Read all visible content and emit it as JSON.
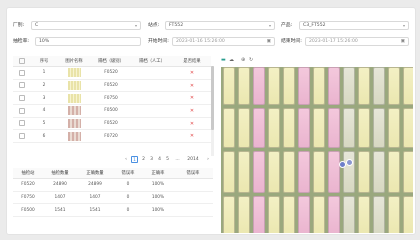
{
  "filters": {
    "factory_label": "厂别:",
    "factory_value": "C",
    "station_label": "站点:",
    "station_value": "FT552",
    "product_label": "产品:",
    "product_value": "C3_FT552",
    "ratio_label": "抽检率:",
    "ratio_value": "10%",
    "start_label": "开始时间:",
    "start_value": "2023-01-16 15:26:00",
    "end_label": "结束时间:",
    "end_value": "2023-01-17 15:26:00"
  },
  "image_table": {
    "headers": [
      "序号",
      "图片名称",
      "隔档（级别）",
      "隔档（人工）",
      "是否结果"
    ],
    "rows": [
      {
        "no": "1",
        "thumb": "a",
        "grade": "F0520",
        "manual": "",
        "result": "✕"
      },
      {
        "no": "2",
        "thumb": "a",
        "grade": "F0520",
        "manual": "",
        "result": "✕"
      },
      {
        "no": "3",
        "thumb": "a",
        "grade": "F0750",
        "manual": "",
        "result": "✕"
      },
      {
        "no": "4",
        "thumb": "b",
        "grade": "F0500",
        "manual": "",
        "result": "✕"
      },
      {
        "no": "5",
        "thumb": "b",
        "grade": "F0520",
        "manual": "",
        "result": "✕"
      },
      {
        "no": "6",
        "thumb": "b",
        "grade": "F0720",
        "manual": "",
        "result": "✕"
      }
    ]
  },
  "pagination": {
    "prev": "‹",
    "pages": [
      "1",
      "2",
      "3",
      "4",
      "5",
      "...",
      "2014"
    ],
    "next": "›"
  },
  "summary_table": {
    "headers": [
      "抽检站",
      "抽检数量",
      "正确数量",
      "错误率",
      "正确率",
      "错误率"
    ],
    "rows": [
      [
        "F0520",
        "24890",
        "24899",
        "0",
        "100%",
        ""
      ],
      [
        "F0750",
        "1407",
        "1407",
        "0",
        "100%",
        ""
      ],
      [
        "F0500",
        "1541",
        "1541",
        "0",
        "100%",
        ""
      ]
    ]
  },
  "viewer": {
    "toolbar_icons": [
      "image-icon",
      "cloud-icon",
      "zoom-icon",
      "refresh-icon"
    ],
    "colors": {
      "yellow": "#f0edbf",
      "pink": "#efbfd6",
      "gray": "#dcdcc9",
      "background": "#9aa87e"
    }
  }
}
